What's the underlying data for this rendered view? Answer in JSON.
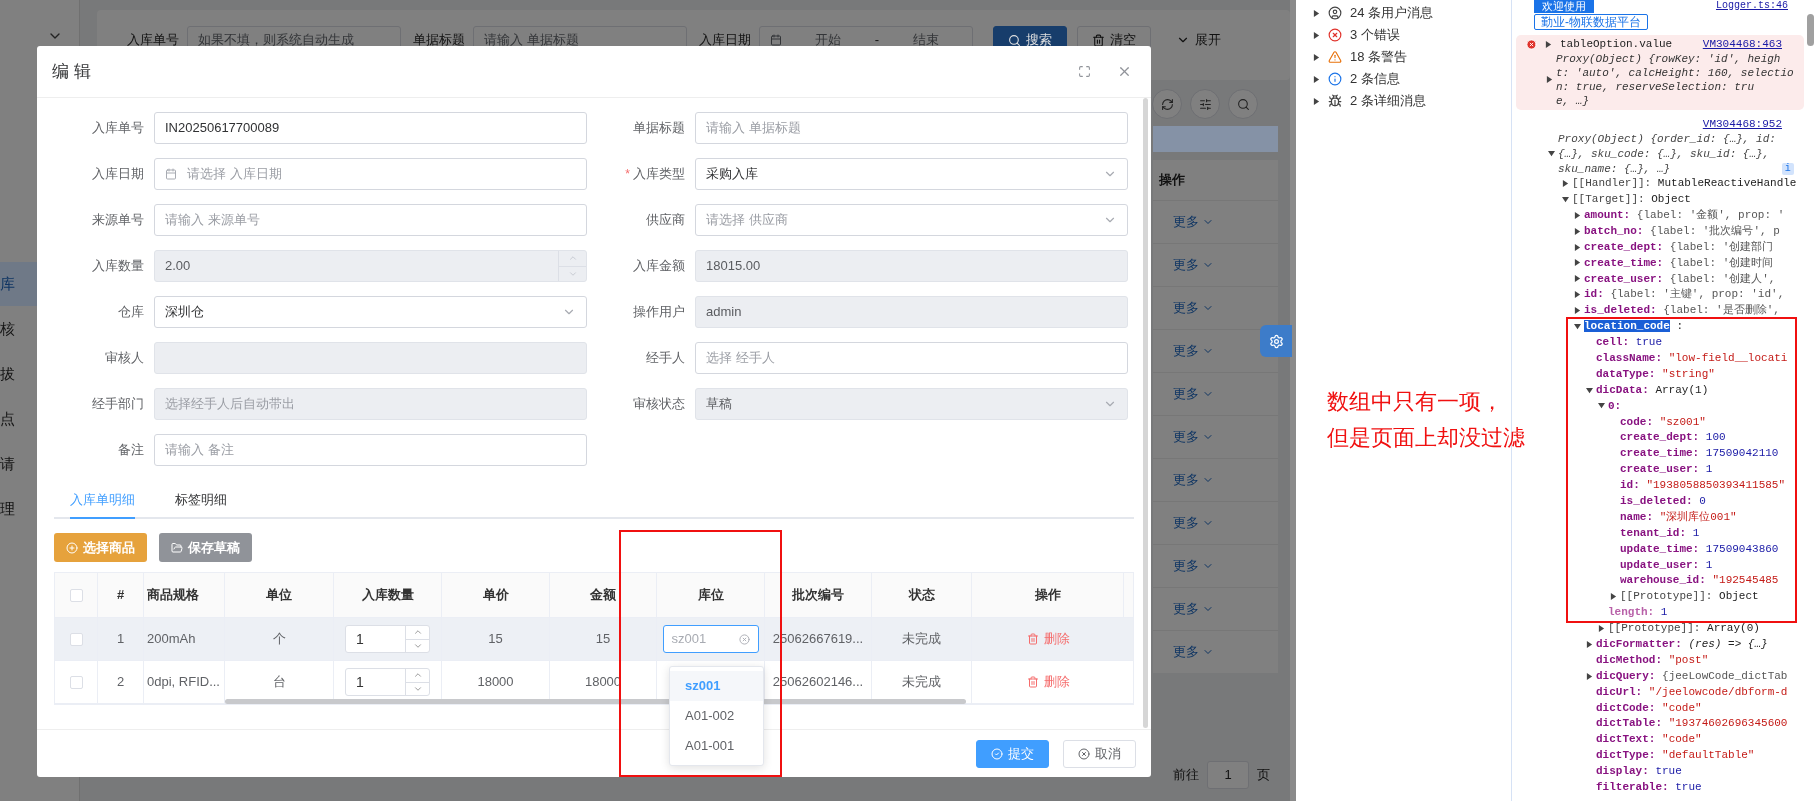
{
  "sidebar": {
    "items": [
      {
        "label": "库",
        "selected": true
      },
      {
        "label": "核",
        "selected": false
      },
      {
        "label": "拔",
        "selected": false
      },
      {
        "label": "点",
        "selected": false
      },
      {
        "label": "请",
        "selected": false
      },
      {
        "label": "理",
        "selected": false
      }
    ]
  },
  "filter_bar": {
    "fields": [
      {
        "kind": "text",
        "label": "入库单号",
        "placeholder": "如果不填，则系统自动生成"
      },
      {
        "kind": "text",
        "label": "单据标题",
        "placeholder": "请输入 单据标题"
      },
      {
        "kind": "daterange",
        "label": "入库日期",
        "start_placeholder": "开始",
        "separator": "-",
        "end_placeholder": "结束"
      }
    ],
    "buttons": [
      {
        "kind": "search",
        "label": "搜索"
      },
      {
        "kind": "clear",
        "label": "清空"
      },
      {
        "kind": "expand",
        "label": "展开"
      }
    ]
  },
  "background_table": {
    "action_header": "操作",
    "row_actions": [
      "更多",
      "更多",
      "更多",
      "更多",
      "更多",
      "更多",
      "更多",
      "更多",
      "更多",
      "更多",
      "更多"
    ]
  },
  "pager": {
    "goto_label": "前往",
    "page": "1",
    "page_suffix": "页"
  },
  "dialog": {
    "title": "编 辑",
    "form": [
      {
        "kind": "text",
        "label": "入库单号",
        "value": "IN20250617700089",
        "disabled": false
      },
      {
        "kind": "text",
        "label": "单据标题",
        "placeholder": "请输入 单据标题",
        "disabled": false
      },
      {
        "kind": "date",
        "label": "入库日期",
        "placeholder": "请选择 入库日期",
        "disabled": false
      },
      {
        "kind": "select",
        "label": "入库类型",
        "required_mark": "*",
        "value": "采购入库",
        "disabled": false
      },
      {
        "kind": "text",
        "label": "来源单号",
        "placeholder": "请输入 来源单号",
        "disabled": false
      },
      {
        "kind": "select",
        "label": "供应商",
        "placeholder": "请选择 供应商",
        "disabled": false
      },
      {
        "kind": "number",
        "label": "入库数量",
        "value": "2.00",
        "disabled": true
      },
      {
        "kind": "text",
        "label": "入库金额",
        "value": "18015.00",
        "disabled": true
      },
      {
        "kind": "select",
        "label": "仓库",
        "value": "深圳仓",
        "disabled": false
      },
      {
        "kind": "text",
        "label": "操作用户",
        "value": "admin",
        "disabled": true
      },
      {
        "kind": "text",
        "label": "审核人",
        "disabled": true
      },
      {
        "kind": "text",
        "label": "经手人",
        "placeholder": "选择 经手人",
        "disabled": false
      },
      {
        "kind": "text",
        "label": "经手部门",
        "placeholder": "选择经手人后自动带出",
        "disabled": true
      },
      {
        "kind": "select",
        "label": "审核状态",
        "value": "草稿",
        "disabled": true
      },
      {
        "kind": "text",
        "label": "备注",
        "placeholder": "请输入 备注",
        "disabled": false
      }
    ],
    "tabs": [
      {
        "label": "入库单明细",
        "selected": true
      },
      {
        "label": "标签明细",
        "selected": false
      }
    ],
    "buttons": [
      {
        "kind": "warning",
        "label": "选择商品"
      },
      {
        "kind": "info",
        "label": "保存草稿"
      }
    ],
    "table": {
      "header_checked": false,
      "columns": [
        "#",
        "商品规格",
        "单位",
        "入库数量",
        "单价",
        "金额",
        "库位",
        "批次编号",
        "状态",
        "操作"
      ],
      "rows": [
        {
          "checked": false,
          "highlighted": true,
          "index": "1",
          "spec": "200mAh",
          "unit": "个",
          "quantity": "1",
          "price": "15",
          "amount": "15",
          "location": {
            "placeholder": "sz001",
            "focused": true
          },
          "batch_no": "25062667619...",
          "status": "未完成",
          "action": "删除"
        },
        {
          "checked": false,
          "highlighted": false,
          "index": "2",
          "spec": "0dpi, RFID...",
          "unit": "台",
          "quantity": "1",
          "price": "18000",
          "amount": "18000",
          "batch_no": "25062602146...",
          "status": "未完成",
          "action": "删除"
        }
      ]
    },
    "dropdown": [
      {
        "label": "sz001",
        "selected": true
      },
      {
        "label": "A01-002",
        "selected": false
      },
      {
        "label": "A01-001",
        "selected": false
      }
    ],
    "footer_buttons": [
      {
        "kind": "primary",
        "label": "提交"
      },
      {
        "kind": "default",
        "label": "取消"
      }
    ]
  },
  "devtools": {
    "message_groups": [
      {
        "kind": "user",
        "label": "24 条用户消息"
      },
      {
        "kind": "error",
        "label": "3 个错误"
      },
      {
        "kind": "warning",
        "label": "18 条警告"
      },
      {
        "kind": "info",
        "label": "2 条信息"
      },
      {
        "kind": "verbose",
        "label": "2 条详细消息"
      }
    ],
    "annotation": [
      "数组中只有一项，",
      "但是页面上却没过滤"
    ],
    "console": {
      "badge": "欢迎使用",
      "top_link": "Logger.ts:46",
      "banner": "勤业-物联数据平台",
      "messages": [
        {
          "kind": "error",
          "text": "tableOption.value",
          "link": "VM304468:463",
          "preview": [
            "Proxy(Object) {rowKey: 'id', heigh",
            "t: 'auto', calcHeight: 160, selectio",
            "n: true, reserveSelection: tru",
            "e, …}"
          ]
        },
        {
          "kind": "log",
          "link": "VM304468:952",
          "preview": [
            "Proxy(Object) {order_id: {…}, id:",
            "{…}, sku_code: {…}, sku_id: {…},",
            "sku_name: {…}, …}"
          ],
          "info_badge": "i",
          "tree": [
            {
              "key": "[[Handler]]:",
              "value": "MutableReactiveHandle",
              "kind": "internal",
              "expanded": false,
              "selected": false
            },
            {
              "key": "[[Target]]:",
              "value": "Object",
              "kind": "internal",
              "expanded": true,
              "selected": false,
              "children": [
                {
                  "key": "amount:",
                  "value": "{label: '金额', prop: '",
                  "kind": "preview",
                  "expanded": false,
                  "selected": false
                },
                {
                  "key": "batch_no:",
                  "value": "{label: '批次编号', p",
                  "kind": "preview",
                  "expanded": false,
                  "selected": false
                },
                {
                  "key": "create_dept:",
                  "value": "{label: '创建部门",
                  "kind": "preview",
                  "expanded": false,
                  "selected": false
                },
                {
                  "key": "create_time:",
                  "value": "{label: '创建时间",
                  "kind": "preview",
                  "expanded": false,
                  "selected": false
                },
                {
                  "key": "create_user:",
                  "value": "{label: '创建人',",
                  "kind": "preview",
                  "expanded": false,
                  "selected": false
                },
                {
                  "key": "id:",
                  "value": "{label: '主键', prop: 'id',",
                  "kind": "preview",
                  "expanded": false,
                  "selected": false
                },
                {
                  "key": "is_deleted:",
                  "value": "{label: '是否删除',",
                  "kind": "preview",
                  "expanded": false,
                  "selected": false
                },
                {
                  "key": "location_code",
                  "value": ":",
                  "kind": "object",
                  "expanded": true,
                  "selected": true,
                  "children": [
                    {
                      "key": "cell:",
                      "value": "true",
                      "kind": "boolean",
                      "selected": false
                    },
                    {
                      "key": "className:",
                      "value": "\"low-field__locati",
                      "kind": "string",
                      "selected": false
                    },
                    {
                      "key": "dataType:",
                      "value": "\"string\"",
                      "kind": "string",
                      "selected": false
                    },
                    {
                      "key": "dicData:",
                      "value": "Array(1)",
                      "kind": "object",
                      "expanded": true,
                      "selected": false,
                      "children": [
                        {
                          "key": "0:",
                          "kind": "object",
                          "expanded": true,
                          "selected": false,
                          "children": [
                            {
                              "key": "code:",
                              "value": "\"sz001\"",
                              "kind": "string",
                              "selected": false
                            },
                            {
                              "key": "create_dept:",
                              "value": "100",
                              "kind": "number",
                              "selected": false
                            },
                            {
                              "key": "create_time:",
                              "value": "17509042110",
                              "kind": "number",
                              "selected": false
                            },
                            {
                              "key": "create_user:",
                              "value": "1",
                              "kind": "number",
                              "selected": false
                            },
                            {
                              "key": "id:",
                              "value": "\"1938058850393411585\"",
                              "kind": "string",
                              "selected": false
                            },
                            {
                              "key": "is_deleted:",
                              "value": "0",
                              "kind": "number",
                              "selected": false
                            },
                            {
                              "key": "name:",
                              "value": "\"深圳库位001\"",
                              "kind": "string",
                              "selected": false
                            },
                            {
                              "key": "tenant_id:",
                              "value": "1",
                              "kind": "number",
                              "selected": false
                            },
                            {
                              "key": "update_time:",
                              "value": "17509043860",
                              "kind": "number",
                              "selected": false
                            },
                            {
                              "key": "update_user:",
                              "value": "1",
                              "kind": "number",
                              "selected": false
                            },
                            {
                              "key": "warehouse_id:",
                              "value": "\"192545485",
                              "kind": "string",
                              "selected": false
                            },
                            {
                              "key": "[[Prototype]]:",
                              "value": "Object",
                              "kind": "internal",
                              "expanded": false,
                              "selected": false
                            }
                          ]
                        },
                        {
                          "key": "length:",
                          "value": "1",
                          "kind": "length",
                          "selected": false
                        },
                        {
                          "key": "[[Prototype]]:",
                          "value": "Array(0)",
                          "kind": "internal",
                          "expanded": false,
                          "selected": false
                        }
                      ]
                    },
                    {
                      "key": "dicFormatter:",
                      "value": "(res) => {…}",
                      "kind": "function",
                      "expanded": false,
                      "selected": false
                    },
                    {
                      "key": "dicMethod:",
                      "value": "\"post\"",
                      "kind": "string",
                      "selected": false
                    },
                    {
                      "key": "dicQuery:",
                      "value": "{jeeLowCode_dictTab",
                      "kind": "preview",
                      "expanded": false,
                      "selected": false
                    },
                    {
                      "key": "dicUrl:",
                      "value": "\"/jeelowcode/dbform-d",
                      "kind": "string",
                      "selected": false
                    },
                    {
                      "key": "dictCode:",
                      "value": "\"code\"",
                      "kind": "string",
                      "selected": false
                    },
                    {
                      "key": "dictTable:",
                      "value": "\"19374602696345600",
                      "kind": "string",
                      "selected": false
                    },
                    {
                      "key": "dictText:",
                      "value": "\"code\"",
                      "kind": "string",
                      "selected": false
                    },
                    {
                      "key": "dictType:",
                      "value": "\"defaultTable\"",
                      "kind": "string",
                      "selected": false
                    },
                    {
                      "key": "display:",
                      "value": "true",
                      "kind": "boolean",
                      "selected": false
                    },
                    {
                      "key": "filterable:",
                      "value": "true",
                      "kind": "boolean",
                      "selected": false
                    }
                  ]
                }
              ]
            }
          ]
        }
      ]
    }
  }
}
